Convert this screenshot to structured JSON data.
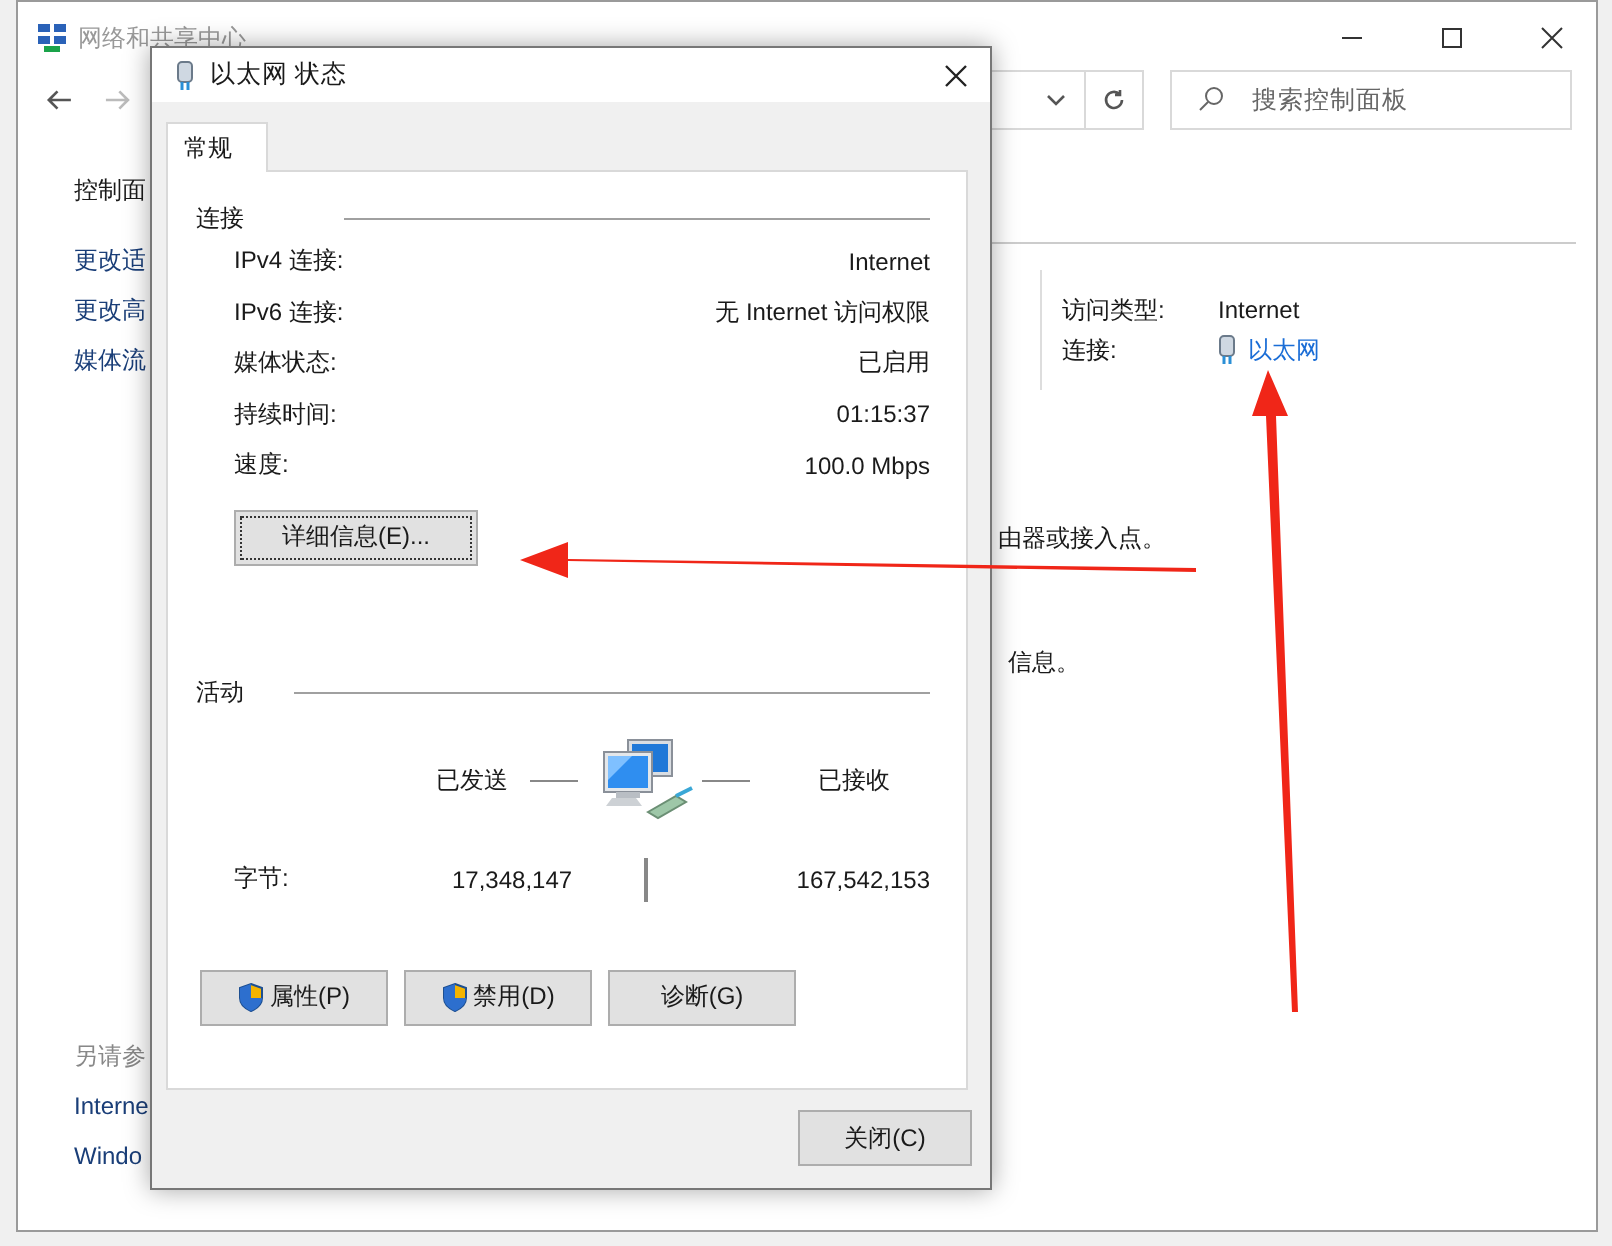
{
  "window": {
    "title": "网络和共享中心",
    "search": {
      "placeholder": "搜索控制面板"
    }
  },
  "sidebar": {
    "items": [
      "控制面",
      "更改适",
      "更改高",
      "媒体流"
    ],
    "see_also": {
      "title": "另请参",
      "items": [
        "Interne",
        "Windo"
      ]
    }
  },
  "connection_info": [
    {
      "label": "访问类型:",
      "value": "Internet",
      "kind": "text"
    },
    {
      "label": "连接:",
      "value": "以太网",
      "kind": "link"
    }
  ],
  "content_fragments": [
    "由器或接入点。",
    "信息。"
  ],
  "dialog": {
    "title": "以太网 状态",
    "tabs": [
      {
        "label": "常规",
        "selected": true
      }
    ],
    "connection": {
      "heading": "连接",
      "rows": [
        {
          "label": "IPv4 连接:",
          "value": "Internet"
        },
        {
          "label": "IPv6 连接:",
          "value": "无 Internet 访问权限"
        },
        {
          "label": "媒体状态:",
          "value": "已启用"
        },
        {
          "label": "持续时间:",
          "value": "01:15:37"
        },
        {
          "label": "速度:",
          "value": "100.0 Mbps"
        }
      ]
    },
    "details_button": "详细信息(E)...",
    "activity": {
      "heading": "活动",
      "sent_label": "已发送",
      "received_label": "已接收",
      "bytes_label": "字节:",
      "sent": "17,348,147",
      "received": "167,542,153"
    },
    "buttons": [
      {
        "label": "属性(P)",
        "shield": true
      },
      {
        "label": "禁用(D)",
        "shield": true
      },
      {
        "label": "诊断(G)",
        "shield": false
      }
    ],
    "close_button": "关闭(C)"
  }
}
